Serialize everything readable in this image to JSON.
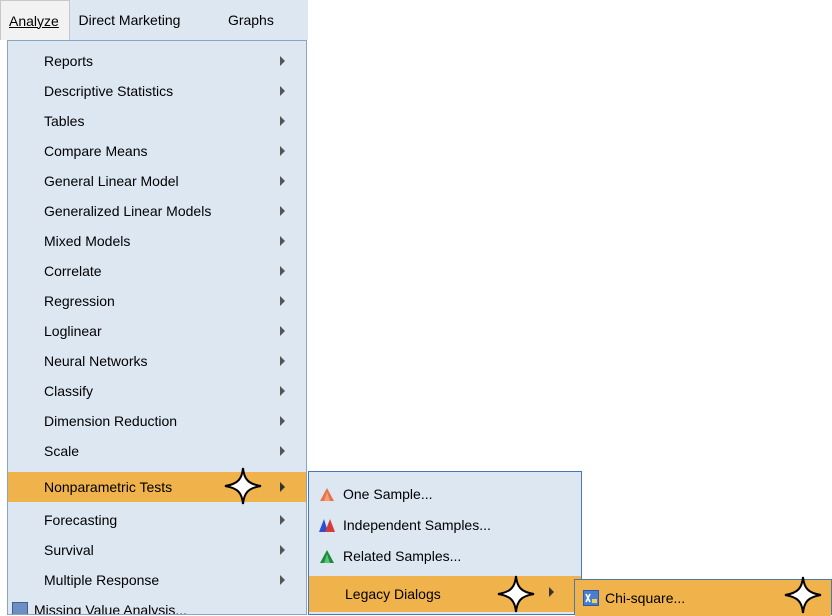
{
  "menubar": {
    "items": [
      {
        "label": "Analyze",
        "active": true
      },
      {
        "label": "Direct Marketing",
        "active": false
      },
      {
        "label": "Graphs",
        "active": false
      }
    ]
  },
  "analyze_menu": {
    "items": [
      {
        "label": "Reports"
      },
      {
        "label": "Descriptive Statistics"
      },
      {
        "label": "Tables"
      },
      {
        "label": "Compare Means"
      },
      {
        "label": "General Linear Model"
      },
      {
        "label": "Generalized Linear Models"
      },
      {
        "label": "Mixed Models"
      },
      {
        "label": "Correlate"
      },
      {
        "label": "Regression"
      },
      {
        "label": "Loglinear"
      },
      {
        "label": "Neural Networks"
      },
      {
        "label": "Classify"
      },
      {
        "label": "Dimension Reduction"
      },
      {
        "label": "Scale"
      },
      {
        "label": "Nonparametric Tests"
      },
      {
        "label": "Forecasting"
      },
      {
        "label": "Survival"
      },
      {
        "label": "Multiple Response"
      },
      {
        "label": "Missing Value Analysis..."
      }
    ]
  },
  "nonparametric_submenu": {
    "items": [
      {
        "label": "One Sample...",
        "icon": "one-sample-icon"
      },
      {
        "label": "Independent Samples...",
        "icon": "independent-samples-icon"
      },
      {
        "label": "Related Samples...",
        "icon": "related-samples-icon"
      },
      {
        "label": "Legacy Dialogs",
        "icon": ""
      }
    ]
  },
  "legacy_submenu": {
    "items": [
      {
        "label": "Chi-square...",
        "icon": "chi-square-icon"
      }
    ]
  },
  "colors": {
    "menu_bg": "#dde7f2",
    "highlight": "#f0b24a",
    "submenu_border": "#4a78b4"
  }
}
